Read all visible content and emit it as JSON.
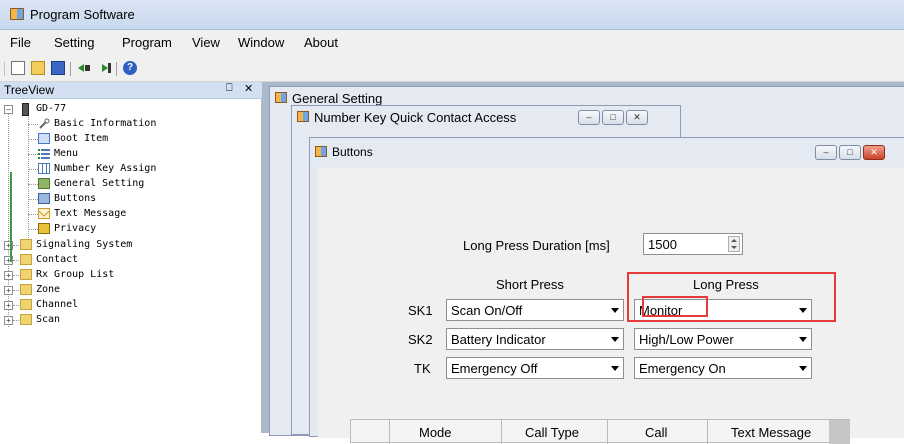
{
  "app": {
    "title": "Program Software",
    "accent": "#e43a3a"
  },
  "menu": {
    "items": [
      "File",
      "Setting",
      "Program",
      "View",
      "Window",
      "About"
    ]
  },
  "toolbar": {
    "icons": [
      "new-file-icon",
      "open-folder-icon",
      "save-icon",
      "read-from-radio-icon",
      "write-to-radio-icon",
      "help-icon"
    ]
  },
  "tree": {
    "title": "TreeView",
    "pin_glyph": "⎕",
    "close_glyph": "✕",
    "root": "GD-77",
    "children": [
      "Basic Information",
      "Boot Item",
      "Menu",
      "Number Key Assign",
      "General Setting",
      "Buttons",
      "Text Message",
      "Privacy"
    ],
    "folders": [
      "Signaling System",
      "Contact",
      "Rx Group List",
      "Zone",
      "Channel",
      "Scan"
    ]
  },
  "windows": {
    "general": {
      "title": "General Setting"
    },
    "number_key": {
      "title": "Number Key Quick Contact Access"
    },
    "buttons": {
      "title": "Buttons"
    }
  },
  "buttons_form": {
    "long_press_label": "Long Press Duration [ms]",
    "long_press_value": "1500",
    "short_press_header": "Short Press",
    "long_press_header": "Long Press",
    "rows": [
      {
        "key": "SK1",
        "short": "Scan On/Off",
        "long": "Monitor"
      },
      {
        "key": "SK2",
        "short": "Battery Indicator",
        "long": "High/Low Power"
      },
      {
        "key": "TK",
        "short": "Emergency Off",
        "long": "Emergency On"
      }
    ],
    "grid_headers": [
      "Mode",
      "Call Type",
      "Call",
      "Text Message"
    ]
  },
  "window_buttons": {
    "minimize": "–",
    "maximize": "□",
    "close": "✕"
  }
}
